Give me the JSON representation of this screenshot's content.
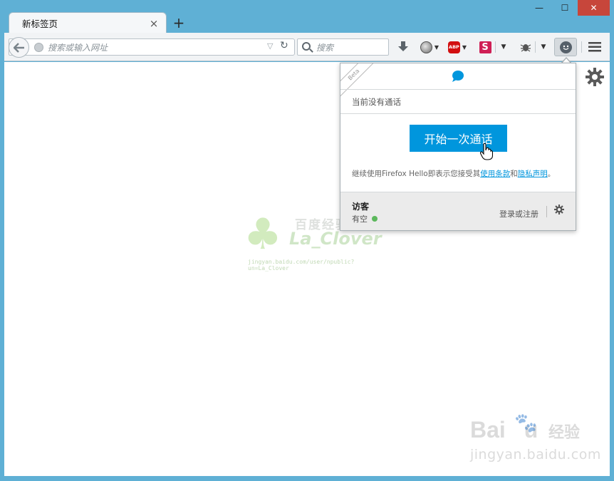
{
  "window": {
    "minimize_glyph": "—",
    "maximize_glyph": "☐",
    "close_glyph": "✕"
  },
  "tab": {
    "title": "新标签页",
    "close_glyph": "×",
    "new_tab_glyph": "+"
  },
  "toolbar": {
    "url_placeholder": "搜索或输入网址",
    "search_placeholder": "搜索",
    "abp_label": "ABP",
    "s_label": "S"
  },
  "hello_panel": {
    "beta_label": "Beta",
    "status": "当前没有通话",
    "start_button": "开始一次通话",
    "terms_prefix": "继续使用Firefox Hello即表示您接受其",
    "terms_link": "使用条款",
    "terms_and": "和",
    "privacy_link": "隐私声明",
    "terms_suffix": "。",
    "user_name": "访客",
    "user_status": "有空",
    "login_link": "登录或注册"
  },
  "watermark": {
    "site_title": "百度经验",
    "author": "La_Clover",
    "author_url": "jingyan.baidu.com/user/npublic?un=La_Clover",
    "baidu_logo": "Bai",
    "baidu_logo_tail": "u",
    "baidu_cn": "经验",
    "baidu_url": "jingyan.baidu.com"
  },
  "colors": {
    "accent": "#0096dd",
    "frame": "#5fb0d5",
    "available": "#5cb85c",
    "close_button": "#c7463b"
  },
  "icons": [
    "back-arrow-icon",
    "globe-icon",
    "reload-icon",
    "search-icon",
    "download-icon",
    "ghostery-icon",
    "adblock-icon",
    "s-extension-icon",
    "bug-icon",
    "hello-icon",
    "menu-icon",
    "gear-icon",
    "chat-bubble-icon",
    "hand-cursor-icon"
  ]
}
